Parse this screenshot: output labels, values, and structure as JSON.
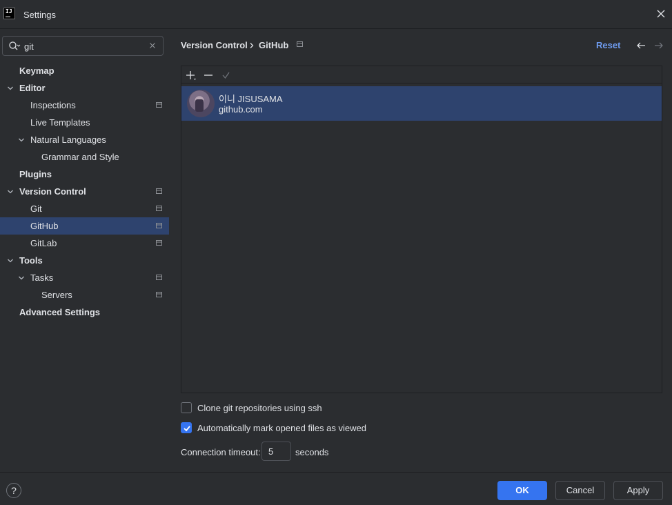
{
  "window": {
    "title": "Settings",
    "logo_text": "IJ"
  },
  "search": {
    "value": "git",
    "placeholder": ""
  },
  "sidebar": {
    "items": [
      {
        "label": "Keymap"
      },
      {
        "label": "Editor"
      },
      {
        "label": "Inspections"
      },
      {
        "label": "Live Templates"
      },
      {
        "label": "Natural Languages"
      },
      {
        "label": "Grammar and Style"
      },
      {
        "label": "Plugins"
      },
      {
        "label": "Version Control"
      },
      {
        "label": "Git"
      },
      {
        "label": "GitHub"
      },
      {
        "label": "GitLab"
      },
      {
        "label": "Tools"
      },
      {
        "label": "Tasks"
      },
      {
        "label": "Servers"
      },
      {
        "label": "Advanced Settings"
      }
    ]
  },
  "breadcrumb": {
    "parent": "Version Control",
    "current": "GitHub"
  },
  "header": {
    "reset_label": "Reset"
  },
  "accounts": {
    "items": [
      {
        "name": "이니  JISUSAMA",
        "server": "github.com"
      }
    ]
  },
  "options": {
    "clone_ssh_label": "Clone git repositories using ssh",
    "clone_ssh_checked": false,
    "auto_mark_label": "Automatically mark opened files as viewed",
    "auto_mark_checked": true,
    "timeout_label": "Connection timeout:",
    "timeout_value": "5",
    "timeout_unit": "seconds"
  },
  "footer": {
    "help_label": "?",
    "ok_label": "OK",
    "cancel_label": "Cancel",
    "apply_label": "Apply"
  },
  "colors": {
    "background": "#2b2d30",
    "selection": "#2e436e",
    "accent": "#3574f0",
    "link": "#6f9cf0",
    "text": "#dfe1e5"
  }
}
